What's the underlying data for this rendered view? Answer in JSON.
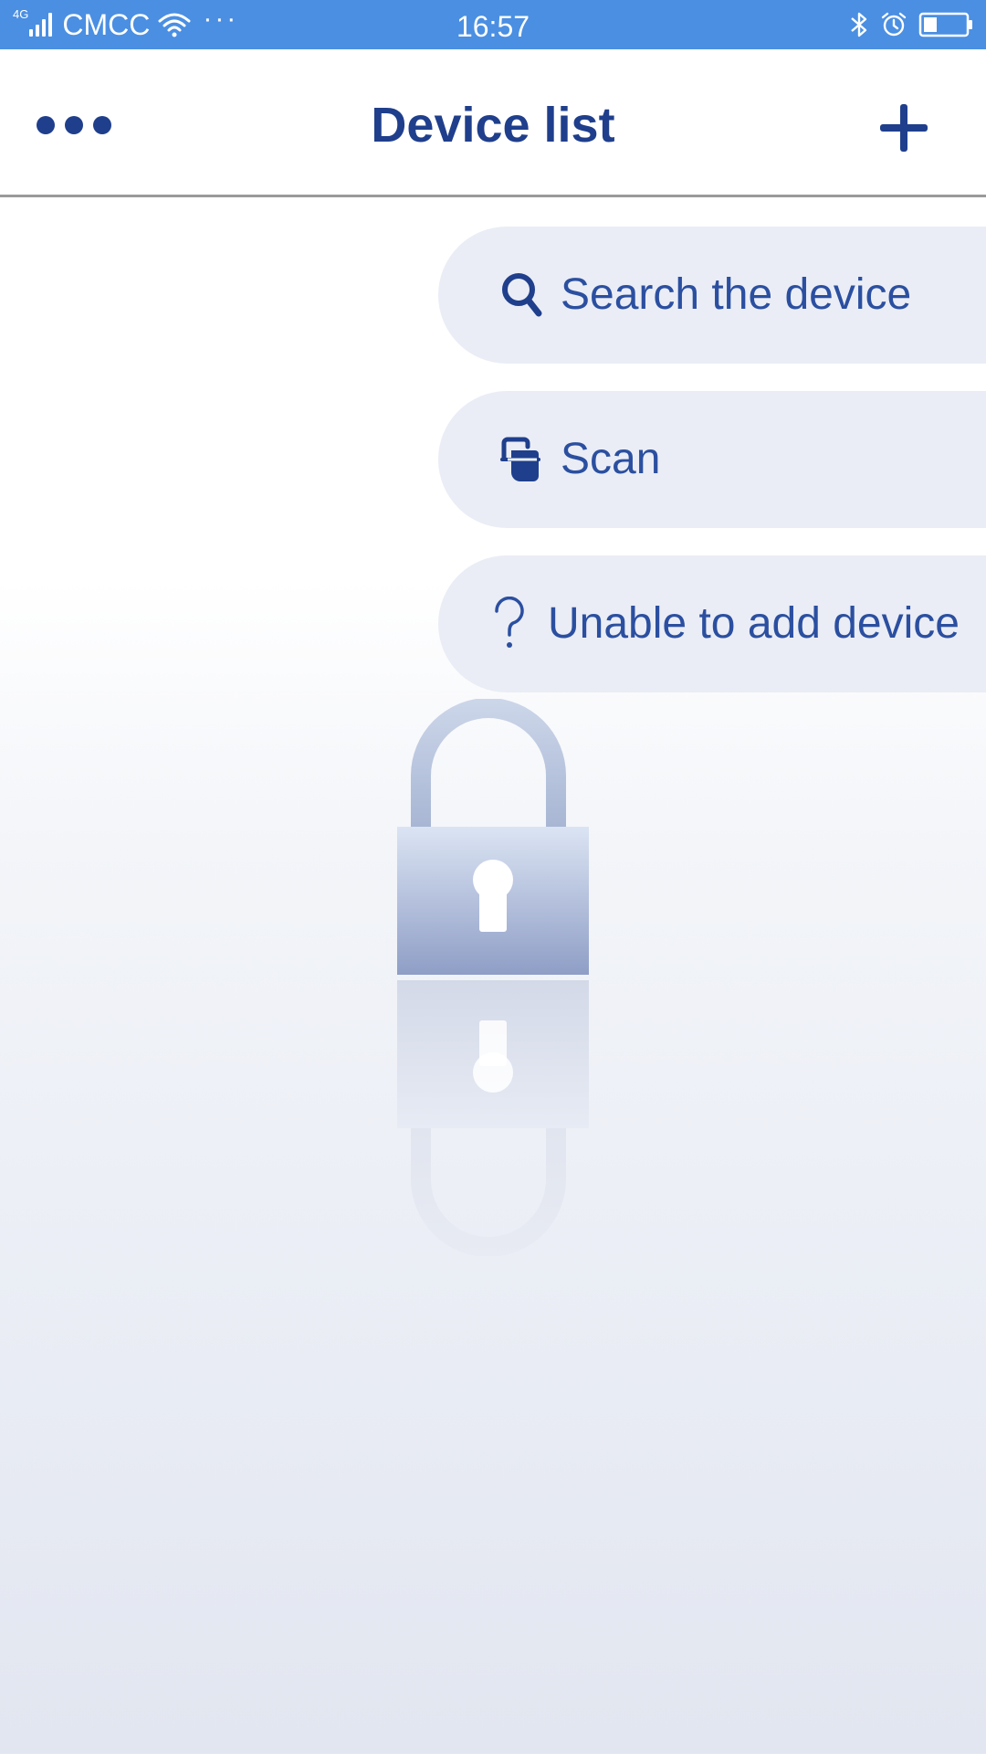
{
  "status_bar": {
    "network_type": "4G",
    "carrier": "CMCC",
    "more_indicator": "···",
    "time": "16:57",
    "icons": [
      "signal-icon",
      "wifi-icon",
      "bluetooth-icon",
      "alarm-icon",
      "battery-icon"
    ]
  },
  "header": {
    "title": "Device list",
    "menu_icon": "more-dots-icon",
    "add_icon": "plus-icon"
  },
  "add_menu": {
    "items": [
      {
        "label": "Search the device",
        "icon": "search-icon"
      },
      {
        "label": "Scan",
        "icon": "scan-icon"
      },
      {
        "label": "Unable to add device",
        "icon": "question-icon"
      }
    ]
  },
  "colors": {
    "status_bar": "#4a8fe2",
    "primary_text": "#1f3f8c",
    "menu_text": "#2b4fa0",
    "menu_bg": "#eaedf5",
    "header_divider": "#9a9a9a"
  }
}
